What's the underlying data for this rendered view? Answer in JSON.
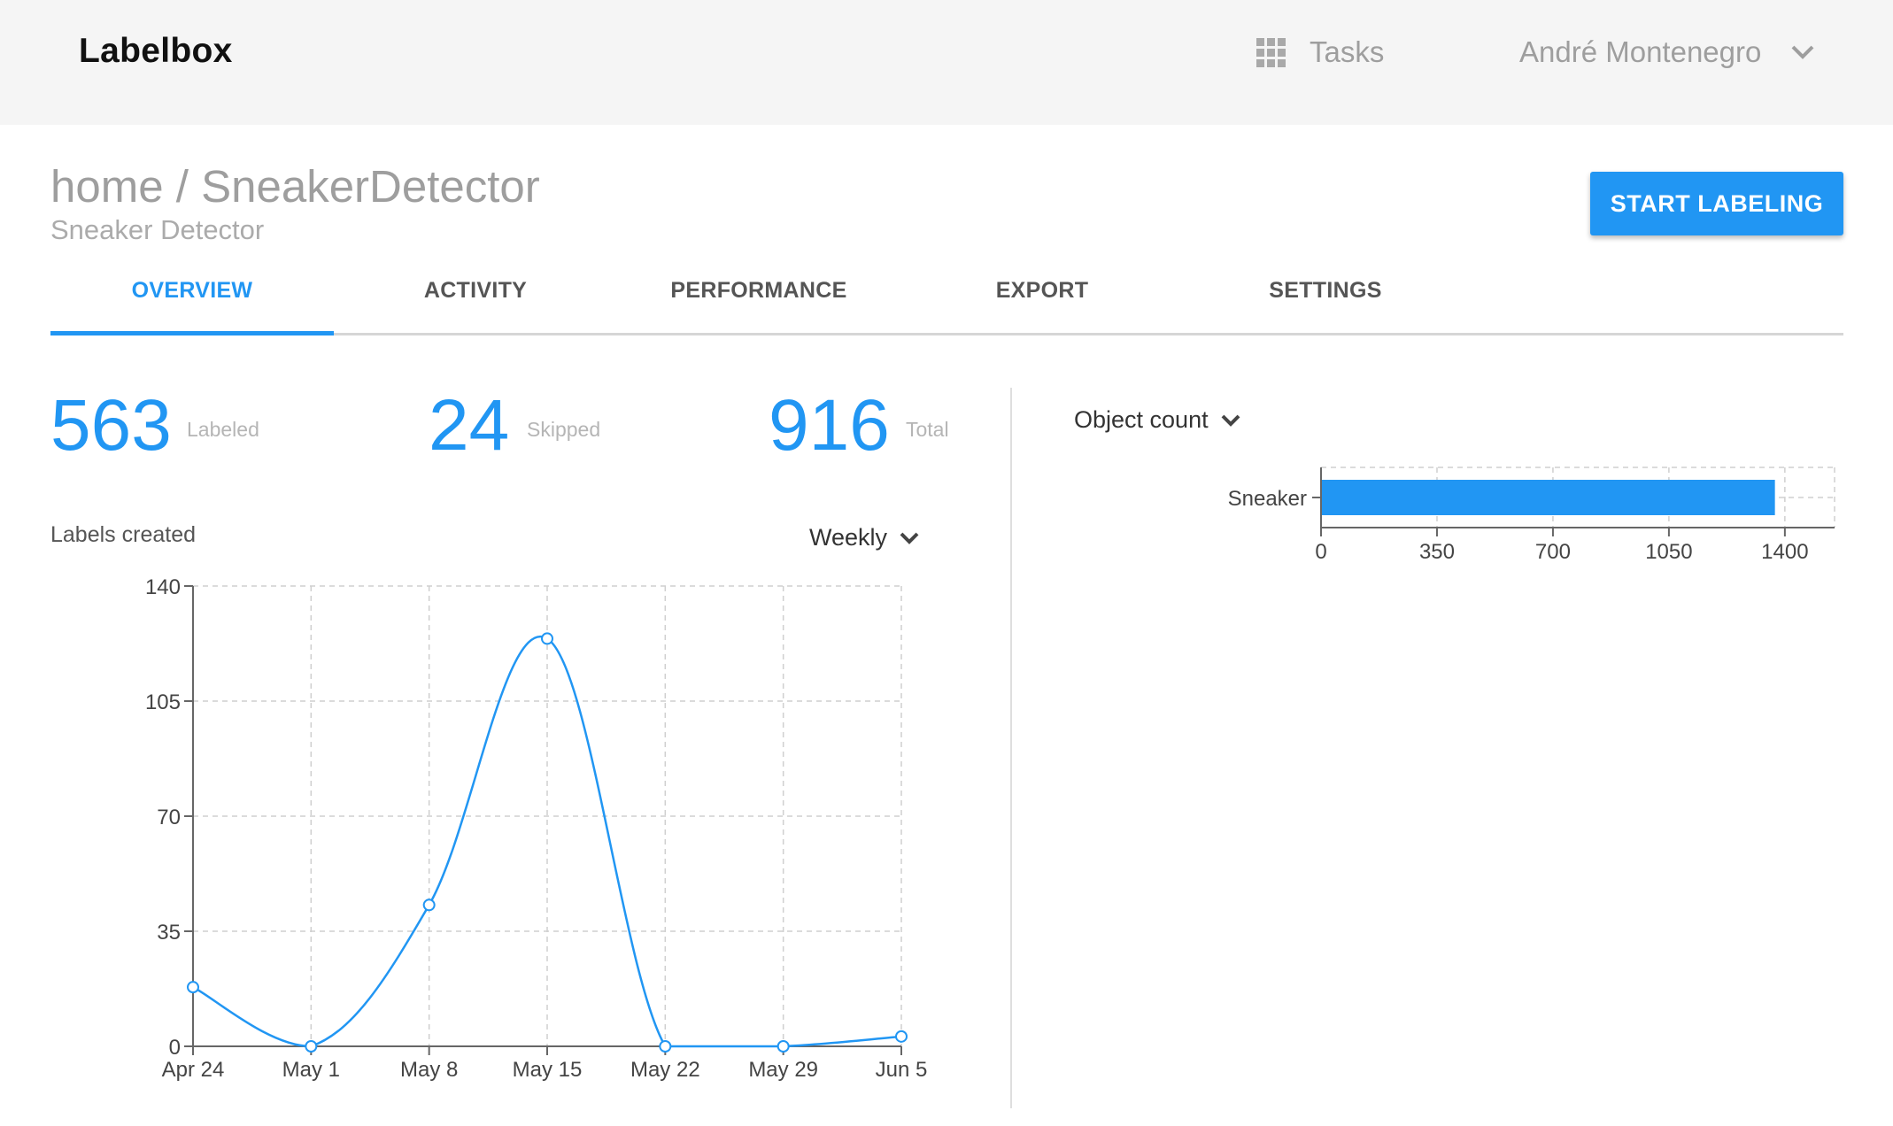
{
  "header": {
    "brand": "Labelbox",
    "tasks_label": "Tasks",
    "user_name": "André Montenegro"
  },
  "page": {
    "breadcrumb": "home / SneakerDetector",
    "subtitle": "Sneaker Detector",
    "start_button": "START LABELING"
  },
  "tabs": [
    {
      "label": "OVERVIEW",
      "active": true
    },
    {
      "label": "ACTIVITY",
      "active": false
    },
    {
      "label": "PERFORMANCE",
      "active": false
    },
    {
      "label": "EXPORT",
      "active": false
    },
    {
      "label": "SETTINGS",
      "active": false
    }
  ],
  "stats": {
    "labeled": {
      "value": "563",
      "label": "Labeled"
    },
    "skipped": {
      "value": "24",
      "label": "Skipped"
    },
    "total": {
      "value": "916",
      "label": "Total"
    }
  },
  "labels_chart": {
    "title": "Labels created",
    "period": "Weekly"
  },
  "object_chart": {
    "selector": "Object count"
  },
  "colors": {
    "accent": "#2196f3",
    "topbar": "#f5f5f5"
  },
  "icons": [
    "apps-grid-icon",
    "chevron-down-icon"
  ],
  "chart_data": [
    {
      "type": "line",
      "x": [
        "Apr 24",
        "May 1",
        "May 8",
        "May 15",
        "May 22",
        "May 29",
        "Jun 5"
      ],
      "values": [
        18,
        0,
        43,
        124,
        0,
        0,
        3
      ],
      "ylim": [
        0,
        140
      ],
      "yticks": [
        0,
        35,
        70,
        105,
        140
      ],
      "grid": true,
      "smooth": true
    },
    {
      "type": "bar",
      "orientation": "horizontal",
      "categories": [
        "Sneaker"
      ],
      "values": [
        1370
      ],
      "xlim": [
        0,
        1550
      ],
      "xticks": [
        0,
        350,
        700,
        1050,
        1400
      ],
      "grid": true
    }
  ]
}
